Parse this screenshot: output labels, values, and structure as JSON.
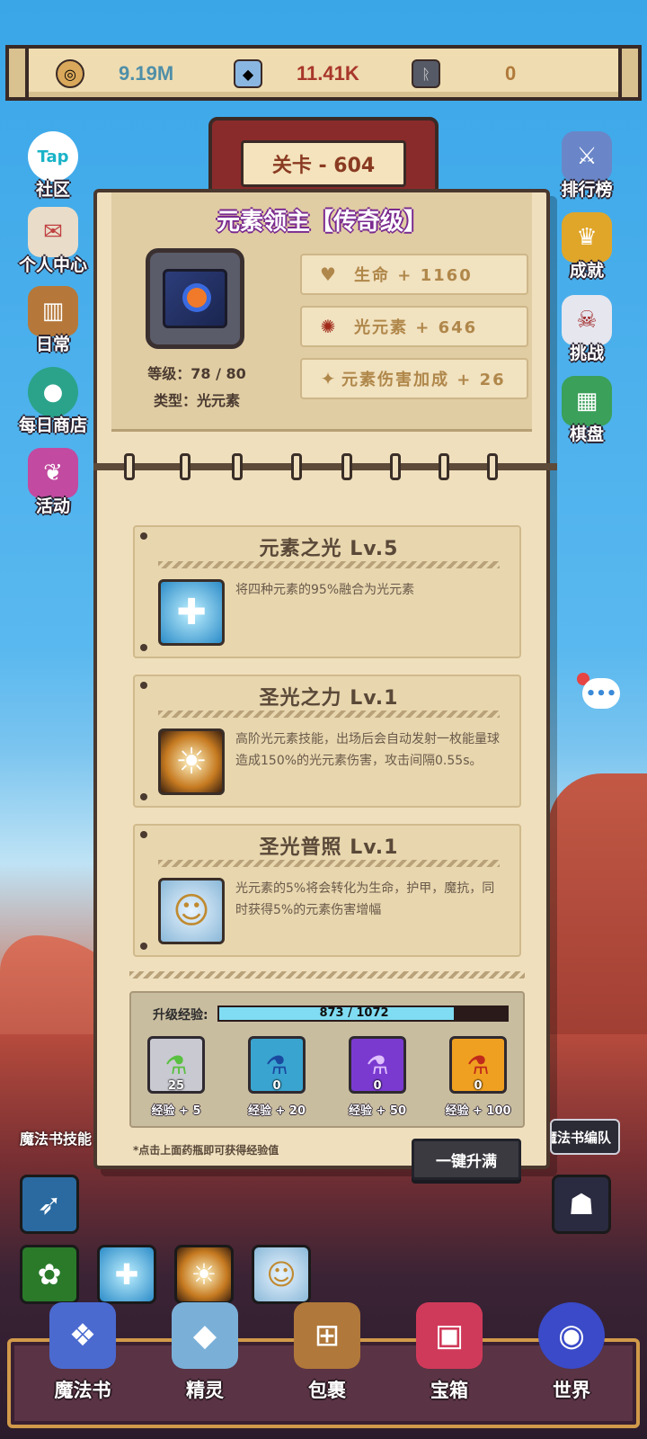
{
  "resources": [
    {
      "icon": "gold-coin-icon",
      "value": "9.19M",
      "color": "#4f8fa8"
    },
    {
      "icon": "crystal-icon",
      "value": "11.41K",
      "color": "#a8372a"
    },
    {
      "icon": "rune-stone-icon",
      "value": "0",
      "color": "#b07a3a"
    }
  ],
  "stage": {
    "label": "关卡 - 604"
  },
  "left_menu": [
    "Tap社区",
    "个人中心",
    "日常",
    "每日商店",
    "活动"
  ],
  "right_menu": [
    "排行榜",
    "成就",
    "挑战",
    "棋盘"
  ],
  "hero": {
    "name": "元素领主【传奇级】",
    "level": "等级：78 / 80",
    "type": "类型：光元素",
    "stats": [
      "生命 + 1160",
      "光元素 + 646",
      "元素伤害加成 + 26"
    ]
  },
  "skills": [
    {
      "title": "元素之光 Lv.5",
      "desc": "将四种元素的95%融合为光元素"
    },
    {
      "title": "圣光之力 Lv.1",
      "desc": "高阶光元素技能，出场后会自动发射一枚能量球造成150%的光元素伤害，攻击间隔0.55s。"
    },
    {
      "title": "圣光普照 Lv.1",
      "desc": "光元素的5%将会转化为生命，护甲，魔抗，同时获得5%的元素伤害增幅"
    }
  ],
  "xp": {
    "label": "升级经验:",
    "text": "873 / 1072",
    "current": 873,
    "max": 1072
  },
  "potions": [
    {
      "count": "25",
      "xp": "经验 + 5",
      "color": "#c9c9d2"
    },
    {
      "count": "0",
      "xp": "经验 + 20",
      "color": "#3aa4d0"
    },
    {
      "count": "0",
      "xp": "经验 + 50",
      "color": "#7a3ad0"
    },
    {
      "count": "0",
      "xp": "经验 + 100",
      "color": "#f0a020"
    }
  ],
  "tip": "*点击上面药瓶即可获得经验值",
  "max_button": "一键升满",
  "grimoire_label": "魔法书技能",
  "team_button": "魔法书编队",
  "nav": [
    "魔法书",
    "精灵",
    "包裹",
    "宝箱",
    "世界"
  ]
}
